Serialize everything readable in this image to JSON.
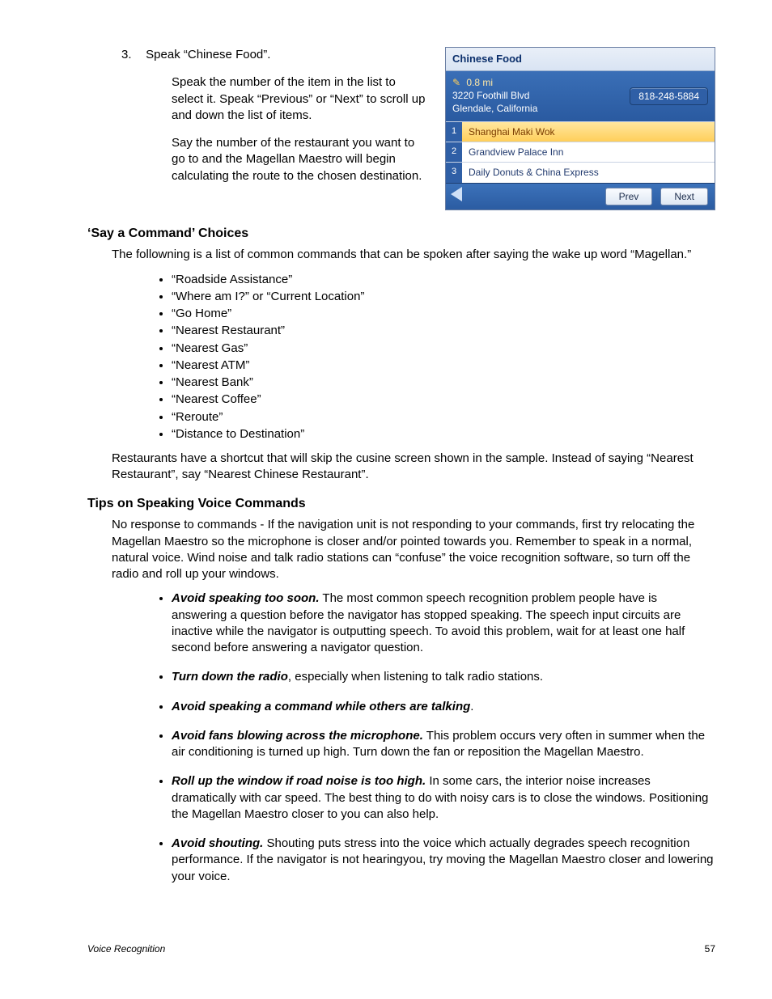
{
  "step": {
    "num": "3.",
    "line1": "Speak “Chinese Food”.",
    "p2": "Speak the number of the item in the list to select it.  Speak “Previous” or “Next” to scroll up and down the list of items.",
    "p3": "Say the number of the restaurant you want to go to and the Magellan Maestro will begin calculating the route to the chosen destination."
  },
  "device": {
    "title": "Chinese Food",
    "distance": "0.8 mi",
    "addr1": "3220 Foothill Blvd",
    "addr2": "Glendale, California",
    "phone": "818-248-5884",
    "rows": [
      {
        "n": "1",
        "t": "Shanghai Maki Wok",
        "sel": true
      },
      {
        "n": "2",
        "t": "Grandview Palace Inn",
        "sel": false
      },
      {
        "n": "3",
        "t": "Daily Donuts & China Express",
        "sel": false
      }
    ],
    "prev": "Prev",
    "next": "Next"
  },
  "sec1": {
    "h": "‘Say a Command’ Choices",
    "intro": "The followning is a list of common commands that can be spoken after saying the wake up word “Magellan.”",
    "cmds": [
      "“Roadside Assistance”",
      "“Where am I?” or “Current Location”",
      "“Go Home”",
      "“Nearest Restaurant”",
      "“Nearest Gas”",
      "“Nearest ATM”",
      "“Nearest Bank”",
      "“Nearest Coffee”",
      "“Reroute”",
      "“Distance to Destination”"
    ],
    "after": "Restaurants have a shortcut that will skip the cusine screen shown in the sample.  Instead of saying “Nearest Restaurant”, say “Nearest Chinese Restaurant”."
  },
  "sec2": {
    "h": "Tips on Speaking Voice Commands",
    "intro": "No response to commands - If the navigation unit is not responding to your commands, first try relocating the Magellan Maestro so the microphone is closer and/or pointed towards you. Remember to speak in a normal, natural voice. Wind noise and talk radio stations can “confuse” the voice recognition software, so turn off the radio and roll up your windows.",
    "tips": [
      {
        "b": "Avoid speaking too soon.",
        "t": "  The most common speech recognition problem people have is answering a question before the navigator has stopped speaking. The speech input circuits are inactive while the navigator is outputting speech. To avoid this problem, wait for at least one half second before answering a navigator question."
      },
      {
        "b": "Turn down the radio",
        "t": ", especially when listening to talk radio stations."
      },
      {
        "b": "Avoid speaking a command while others are talking",
        "t": "."
      },
      {
        "b": "Avoid fans blowing across the microphone.",
        "t": "  This problem occurs very often in summer when the air conditioning is turned up high. Turn down the fan or reposition the Magellan Maestro."
      },
      {
        "b": "Roll up the window if road noise is too high.",
        "t": "  In some cars, the interior noise increases dramatically with car speed. The best thing to do with noisy cars is to close the windows. Positioning the Magellan Maestro closer to you can also help."
      },
      {
        "b": "Avoid shouting.",
        "t": "  Shouting puts stress into the voice which actually degrades speech recognition performance. If the navigator is not hearingyou, try moving the Magellan Maestro closer and lowering your voice."
      }
    ]
  },
  "footer": {
    "section": "Voice Recognition",
    "page": "57"
  }
}
